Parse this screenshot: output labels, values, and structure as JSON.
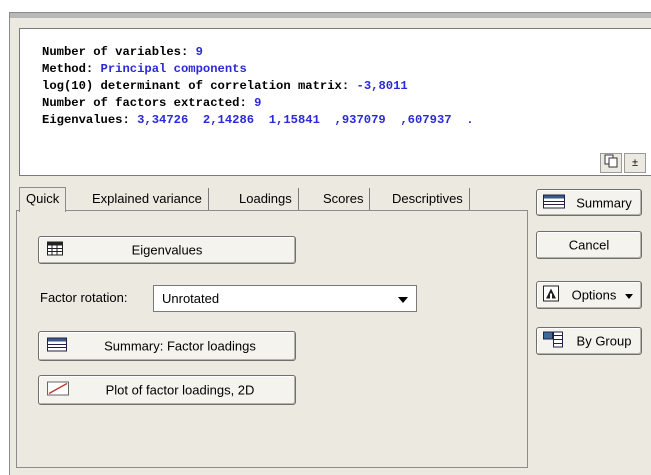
{
  "summary": {
    "lines": [
      {
        "label": "Number of variables: ",
        "value": "9"
      },
      {
        "label": "Method: ",
        "value": "Principal components"
      },
      {
        "label": "log(10) determinant of correlation matrix: ",
        "value": "-3,8011"
      },
      {
        "label": "Number of factors extracted: ",
        "value": "9"
      },
      {
        "label": "Eigenvalues: ",
        "value": "3,34726  2,14286  1,15841  ,937079  ,607937  ."
      }
    ],
    "mini_button_right_label": "±"
  },
  "tabs": [
    {
      "label": "Quick",
      "active": true
    },
    {
      "label": "Explained variance",
      "active": false
    },
    {
      "label": "Loadings",
      "active": false
    },
    {
      "label": "Scores",
      "active": false
    },
    {
      "label": "Descriptives",
      "active": false
    }
  ],
  "quick": {
    "eigenvalues_button": "Eigenvalues",
    "factor_rotation_label": "Factor rotation:",
    "factor_rotation_value": "Unrotated",
    "summary_loadings_button": "Summary: Factor loadings",
    "plot_loadings_button": "Plot of factor loadings, 2D"
  },
  "side_buttons": {
    "summary": "Summary",
    "cancel": "Cancel",
    "options": "Options",
    "by_group": "By Group"
  }
}
